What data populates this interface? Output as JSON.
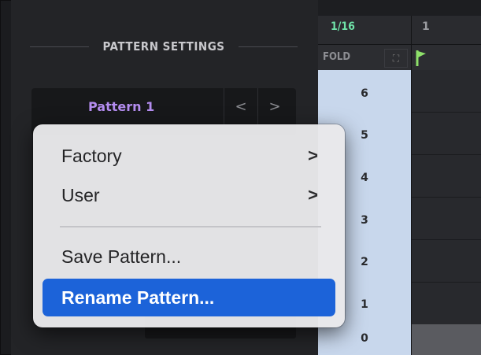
{
  "settings": {
    "title": "PATTERN SETTINGS",
    "pattern_name": "Pattern 1",
    "prev_label": "<",
    "next_label": ">"
  },
  "grid": {
    "resolution": "1/16",
    "bar_number": "1",
    "fold_label": "FOLD",
    "row_labels": [
      "6",
      "5",
      "4",
      "3",
      "2",
      "1",
      "0"
    ]
  },
  "context_menu": {
    "items": [
      {
        "label": "Factory",
        "has_submenu": true
      },
      {
        "label": "User",
        "has_submenu": true
      },
      {
        "label": "Save Pattern...",
        "has_submenu": false
      },
      {
        "label": "Rename Pattern...",
        "has_submenu": false,
        "highlighted": true
      }
    ],
    "submenu_chevron": ">"
  },
  "colors": {
    "accent_highlight": "#1c63d9",
    "pattern_name": "#b48df0",
    "resolution": "#6fe2a8",
    "flag": "#8ee06a",
    "row_label_bg": "#c8d7ec"
  },
  "icons": {
    "flag": "flag-icon",
    "fold": "expand-icon",
    "submenu": "chevron-right-icon"
  }
}
